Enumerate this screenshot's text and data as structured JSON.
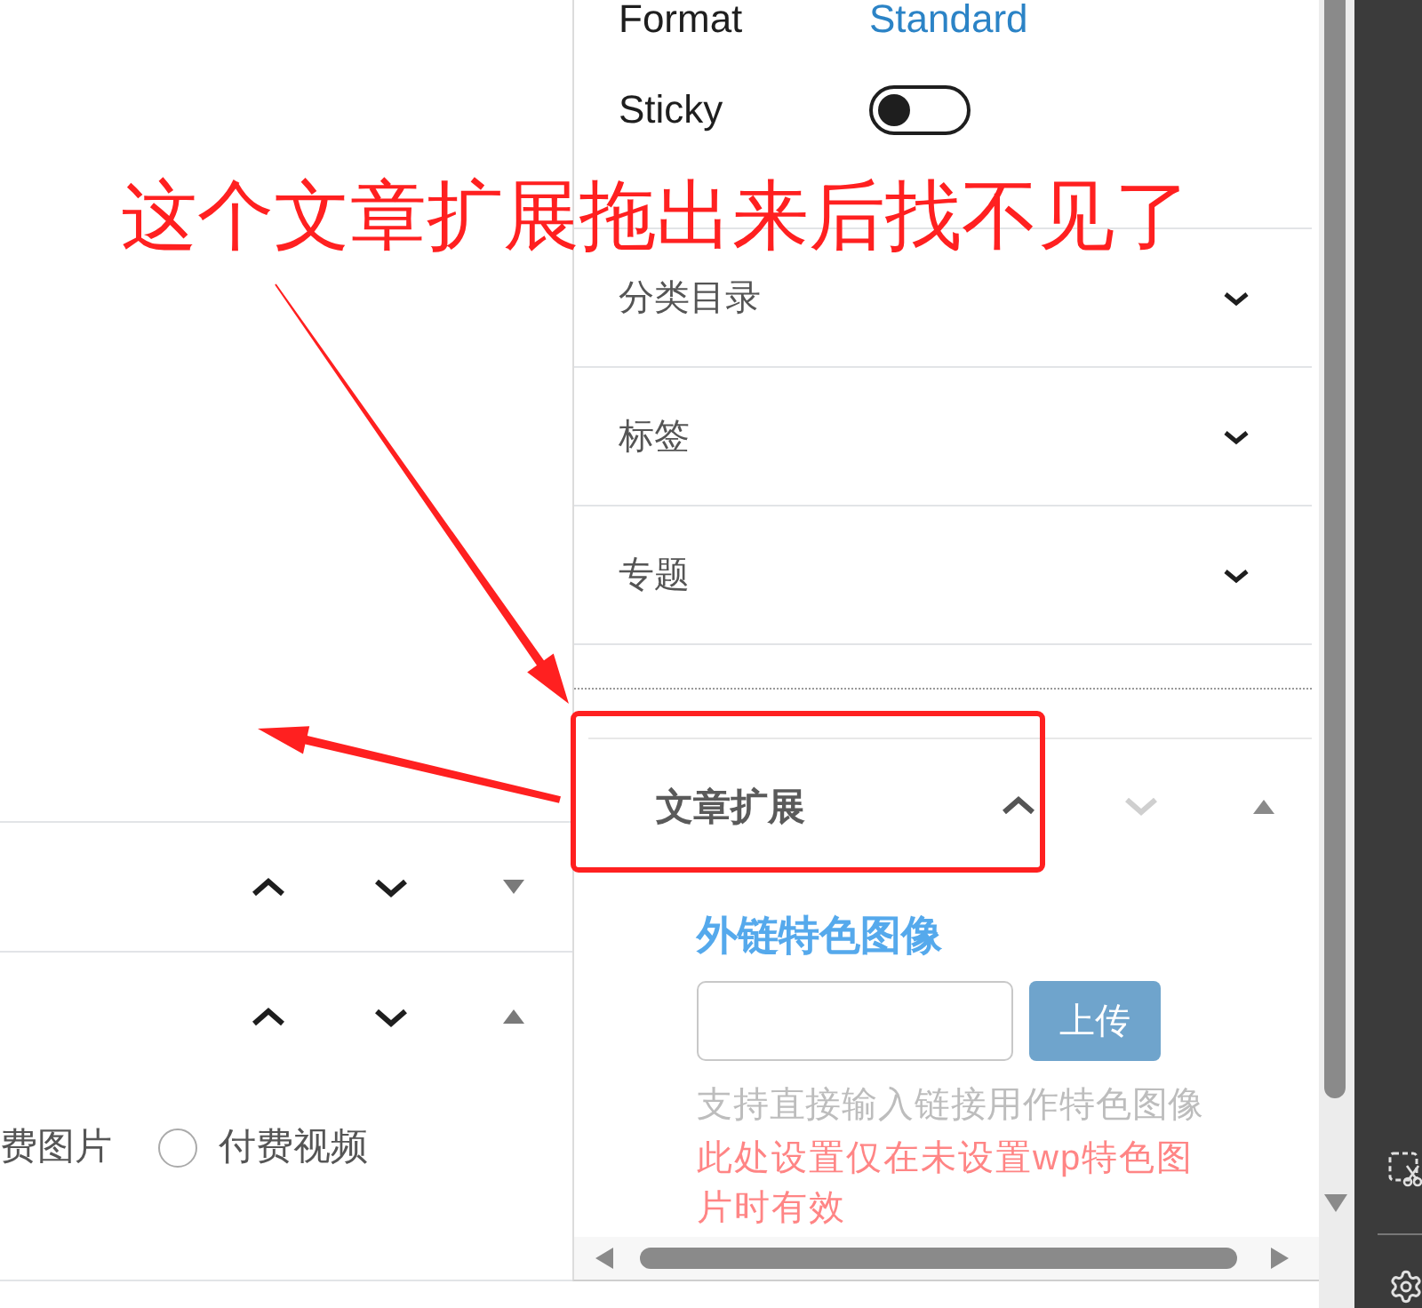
{
  "annotation": {
    "text": "这个文章扩展拖出来后找不见了"
  },
  "editor": {
    "boxes": [
      {
        "expanded": false,
        "move_up_disabled": false,
        "move_down_disabled": false
      },
      {
        "expanded": true,
        "move_up_disabled": false,
        "move_down_disabled": false,
        "clipped_option": "费图片",
        "options": [
          {
            "label": "付费视频",
            "selected": false
          }
        ]
      }
    ]
  },
  "sidebar": {
    "format": {
      "label": "Format",
      "value": "Standard"
    },
    "sticky": {
      "label": "Sticky",
      "on": false
    },
    "panels": [
      {
        "title": "分类目录",
        "expanded": false
      },
      {
        "title": "标签",
        "expanded": false
      },
      {
        "title": "专题",
        "expanded": false
      }
    ],
    "extension": {
      "title": "文章扩展",
      "expanded": true,
      "move_up_disabled": false,
      "move_down_disabled": true,
      "field_label": "外链特色图像",
      "button": "上传",
      "help": "支持直接输入链接用作特色图像",
      "warning": "此处设置仅在未设置wp特色图片时有效"
    }
  }
}
